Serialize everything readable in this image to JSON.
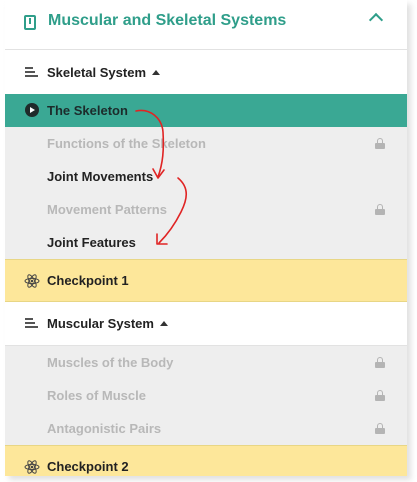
{
  "header": {
    "title": "Muscular and Skeletal Systems",
    "icon": "book-icon",
    "toggle_icon": "chevron-up-icon"
  },
  "sections": [
    {
      "label": "Skeletal System",
      "icon": "list-icon",
      "caret_icon": "caret-up-icon",
      "active_lesson": "The Skeleton",
      "lessons": [
        {
          "label": "Functions of the Skeleton",
          "locked": true
        },
        {
          "label": "Joint Movements",
          "locked": false
        },
        {
          "label": "Movement Patterns",
          "locked": true
        },
        {
          "label": "Joint Features",
          "locked": false
        }
      ],
      "checkpoint": "Checkpoint 1"
    },
    {
      "label": "Muscular System",
      "icon": "list-icon",
      "caret_icon": "caret-up-icon",
      "lessons": [
        {
          "label": "Muscles of the Body",
          "locked": true
        },
        {
          "label": "Roles of Muscle",
          "locked": true
        },
        {
          "label": "Antagonistic Pairs",
          "locked": true
        }
      ],
      "checkpoint": "Checkpoint 2"
    }
  ],
  "colors": {
    "accent": "#3aa894",
    "checkpoint_bg": "#fde79a",
    "locked_text": "#b8b8b8",
    "annotation_arrow": "#e02424"
  }
}
